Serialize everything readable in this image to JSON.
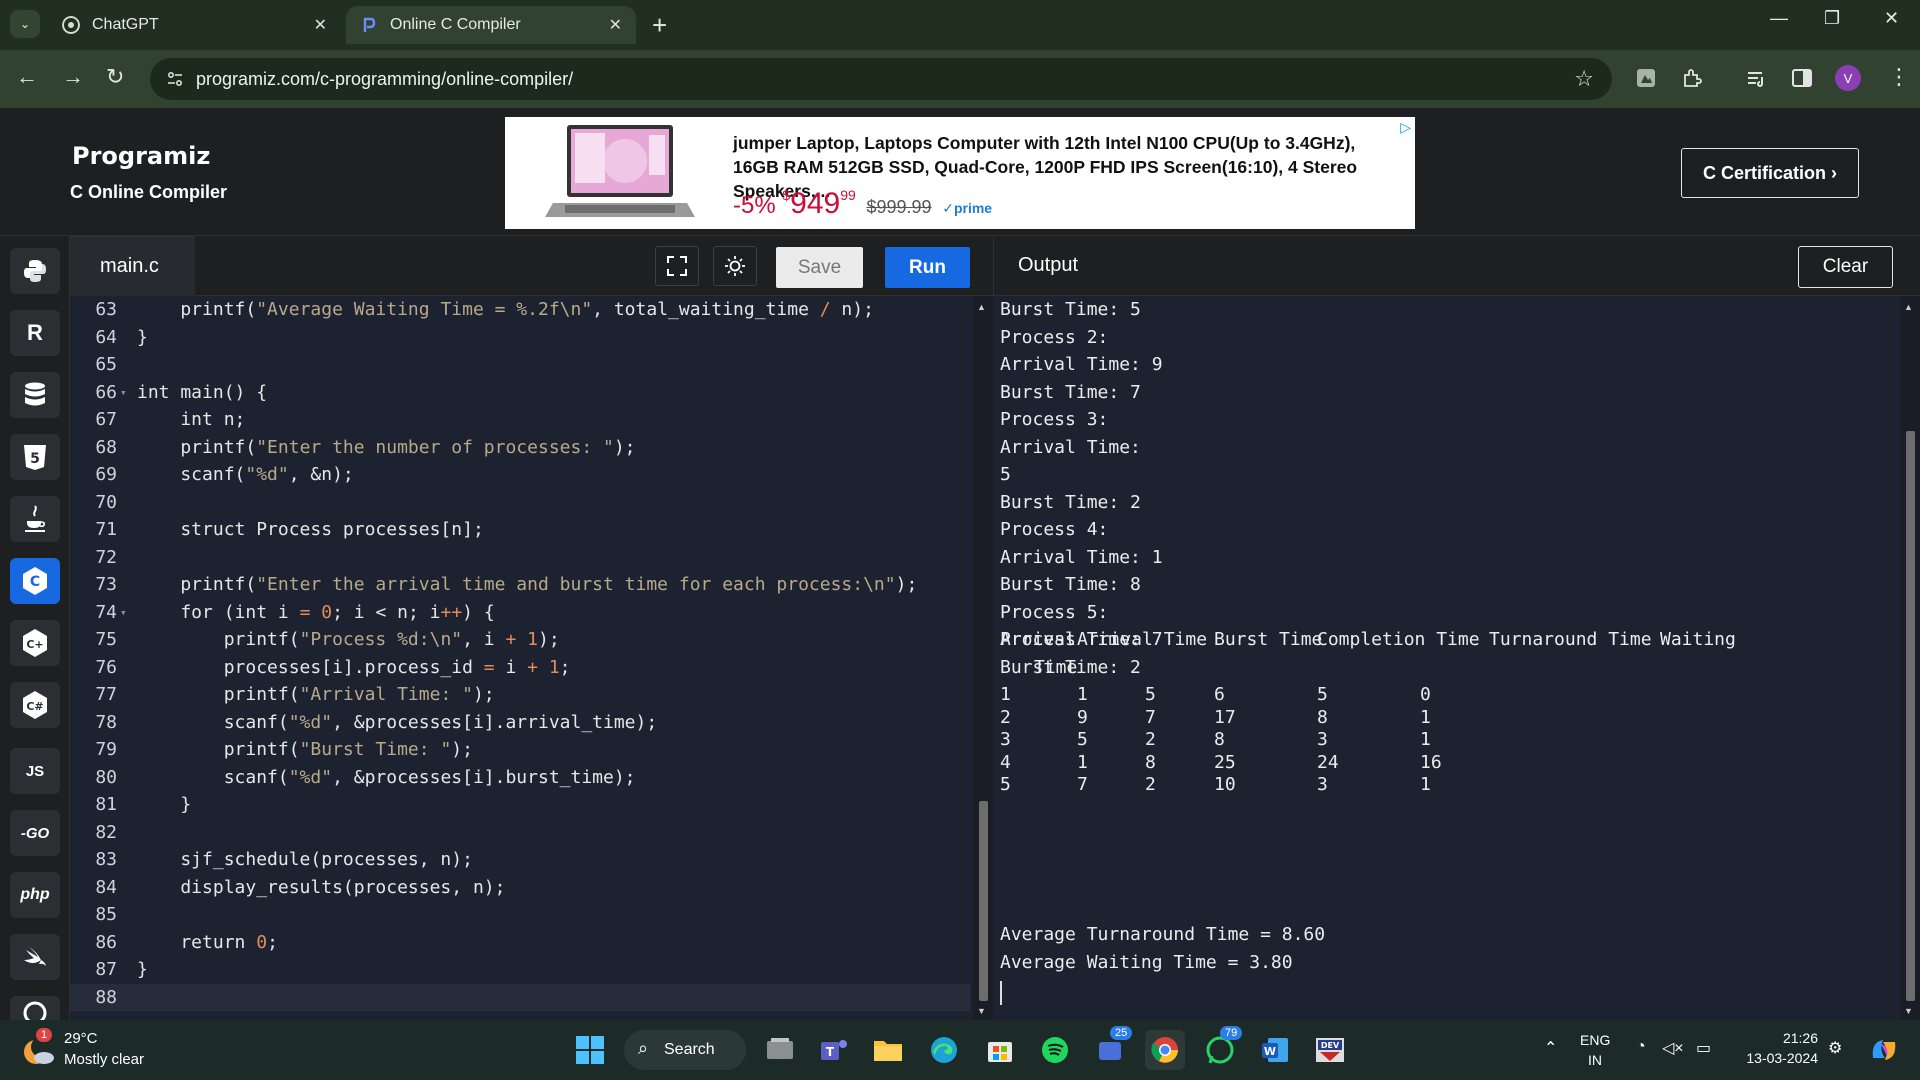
{
  "browser": {
    "tabs": [
      {
        "title": "ChatGPT",
        "active": false
      },
      {
        "title": "Online C Compiler",
        "active": true
      }
    ],
    "url": "programiz.com/c-programming/online-compiler/",
    "profile_initial": "V"
  },
  "header": {
    "logo": "Programiz",
    "subtitle": "C Online Compiler",
    "certification_button": "C Certification ›",
    "ad": {
      "title": "jumper Laptop, Laptops Computer with 12th Intel N100 CPU(Up to 3.4GHz), 16GB RAM 512GB SSD, Quad-Core, 1200P FHD IPS Screen(16:10), 4 Stereo Speakers,...",
      "discount": "-5%",
      "currency": "$",
      "price_main": "949",
      "price_fraction": "99",
      "old_price": "$999.99",
      "prime": "✓prime"
    }
  },
  "sidebar": {
    "languages": [
      {
        "name": "python-icon",
        "label": "",
        "active": false
      },
      {
        "name": "r-icon",
        "label": "R",
        "active": false
      },
      {
        "name": "sql-icon",
        "label": "",
        "active": false
      },
      {
        "name": "html-icon",
        "label": "5",
        "active": false
      },
      {
        "name": "java-icon",
        "label": "",
        "active": false
      },
      {
        "name": "c-icon",
        "label": "C",
        "active": true
      },
      {
        "name": "cpp-icon",
        "label": "C+",
        "active": false
      },
      {
        "name": "csharp-icon",
        "label": "C#",
        "active": false
      },
      {
        "name": "js-icon",
        "label": "JS",
        "active": false
      },
      {
        "name": "go-icon",
        "label": "-GO",
        "active": false
      },
      {
        "name": "php-icon",
        "label": "php",
        "active": false
      },
      {
        "name": "swift-icon",
        "label": "",
        "active": false
      },
      {
        "name": "rust-icon",
        "label": "",
        "active": false
      }
    ]
  },
  "editor": {
    "filename": "main.c",
    "save_label": "Save",
    "run_label": "Run",
    "lines": [
      {
        "n": "63",
        "code": "    printf(\"Average Waiting Time = %.2f\\n\", total_waiting_time / n);"
      },
      {
        "n": "64",
        "code": "}"
      },
      {
        "n": "65",
        "code": ""
      },
      {
        "n": "66",
        "code": "int main() {",
        "fold": true
      },
      {
        "n": "67",
        "code": "    int n;"
      },
      {
        "n": "68",
        "code": "    printf(\"Enter the number of processes: \");"
      },
      {
        "n": "69",
        "code": "    scanf(\"%d\", &n);"
      },
      {
        "n": "70",
        "code": ""
      },
      {
        "n": "71",
        "code": "    struct Process processes[n];"
      },
      {
        "n": "72",
        "code": ""
      },
      {
        "n": "73",
        "code": "    printf(\"Enter the arrival time and burst time for each process:\\n\");"
      },
      {
        "n": "74",
        "code": "    for (int i = 0; i < n; i++) {",
        "fold": true
      },
      {
        "n": "75",
        "code": "        printf(\"Process %d:\\n\", i + 1);"
      },
      {
        "n": "76",
        "code": "        processes[i].process_id = i + 1;"
      },
      {
        "n": "77",
        "code": "        printf(\"Arrival Time: \");"
      },
      {
        "n": "78",
        "code": "        scanf(\"%d\", &processes[i].arrival_time);"
      },
      {
        "n": "79",
        "code": "        printf(\"Burst Time: \");"
      },
      {
        "n": "80",
        "code": "        scanf(\"%d\", &processes[i].burst_time);"
      },
      {
        "n": "81",
        "code": "    }"
      },
      {
        "n": "82",
        "code": ""
      },
      {
        "n": "83",
        "code": "    sjf_schedule(processes, n);"
      },
      {
        "n": "84",
        "code": "    display_results(processes, n);"
      },
      {
        "n": "85",
        "code": ""
      },
      {
        "n": "86",
        "code": "    return 0;"
      },
      {
        "n": "87",
        "code": "}"
      },
      {
        "n": "88",
        "code": "",
        "current": true
      }
    ]
  },
  "output": {
    "title": "Output",
    "clear_label": "Clear",
    "log_lines": [
      "Burst Time: 5",
      "Process 2:",
      "Arrival Time: 9",
      "Burst Time: 7",
      "Process 3:",
      "Arrival Time:",
      "5",
      "Burst Time: 2",
      "Process 4:",
      "Arrival Time: 1",
      "Burst Time: 8",
      "Process 5:",
      "Arrival Time: 7",
      "Burst Time: 2"
    ],
    "table_header": [
      "Process",
      "Arrival Time",
      "Burst Time",
      "Completion Time",
      "Turnaround Time",
      "Waiting"
    ],
    "table_header_wrap": "Time",
    "table_rows": [
      [
        "1",
        "1",
        "5",
        "6",
        "5",
        "0"
      ],
      [
        "2",
        "9",
        "7",
        "17",
        "8",
        "1"
      ],
      [
        "3",
        "5",
        "2",
        "8",
        "3",
        "1"
      ],
      [
        "4",
        "1",
        "8",
        "25",
        "24",
        "16"
      ],
      [
        "5",
        "7",
        "2",
        "10",
        "3",
        "1"
      ]
    ],
    "avg_turnaround": "Average Turnaround Time = 8.60",
    "avg_waiting": "Average Waiting Time = 3.80"
  },
  "taskbar": {
    "weather_temp": "29°C",
    "weather_desc": "Mostly clear",
    "weather_alert": "1",
    "search_label": "Search",
    "badge_teams": "25",
    "badge_whatsapp": "79",
    "lang_top": "ENG",
    "lang_bottom": "IN",
    "time": "21:26",
    "date": "13-03-2024"
  },
  "colors": {
    "accent": "#1669e0",
    "editor_bg": "#1d2230",
    "browser_bg": "#314231"
  }
}
